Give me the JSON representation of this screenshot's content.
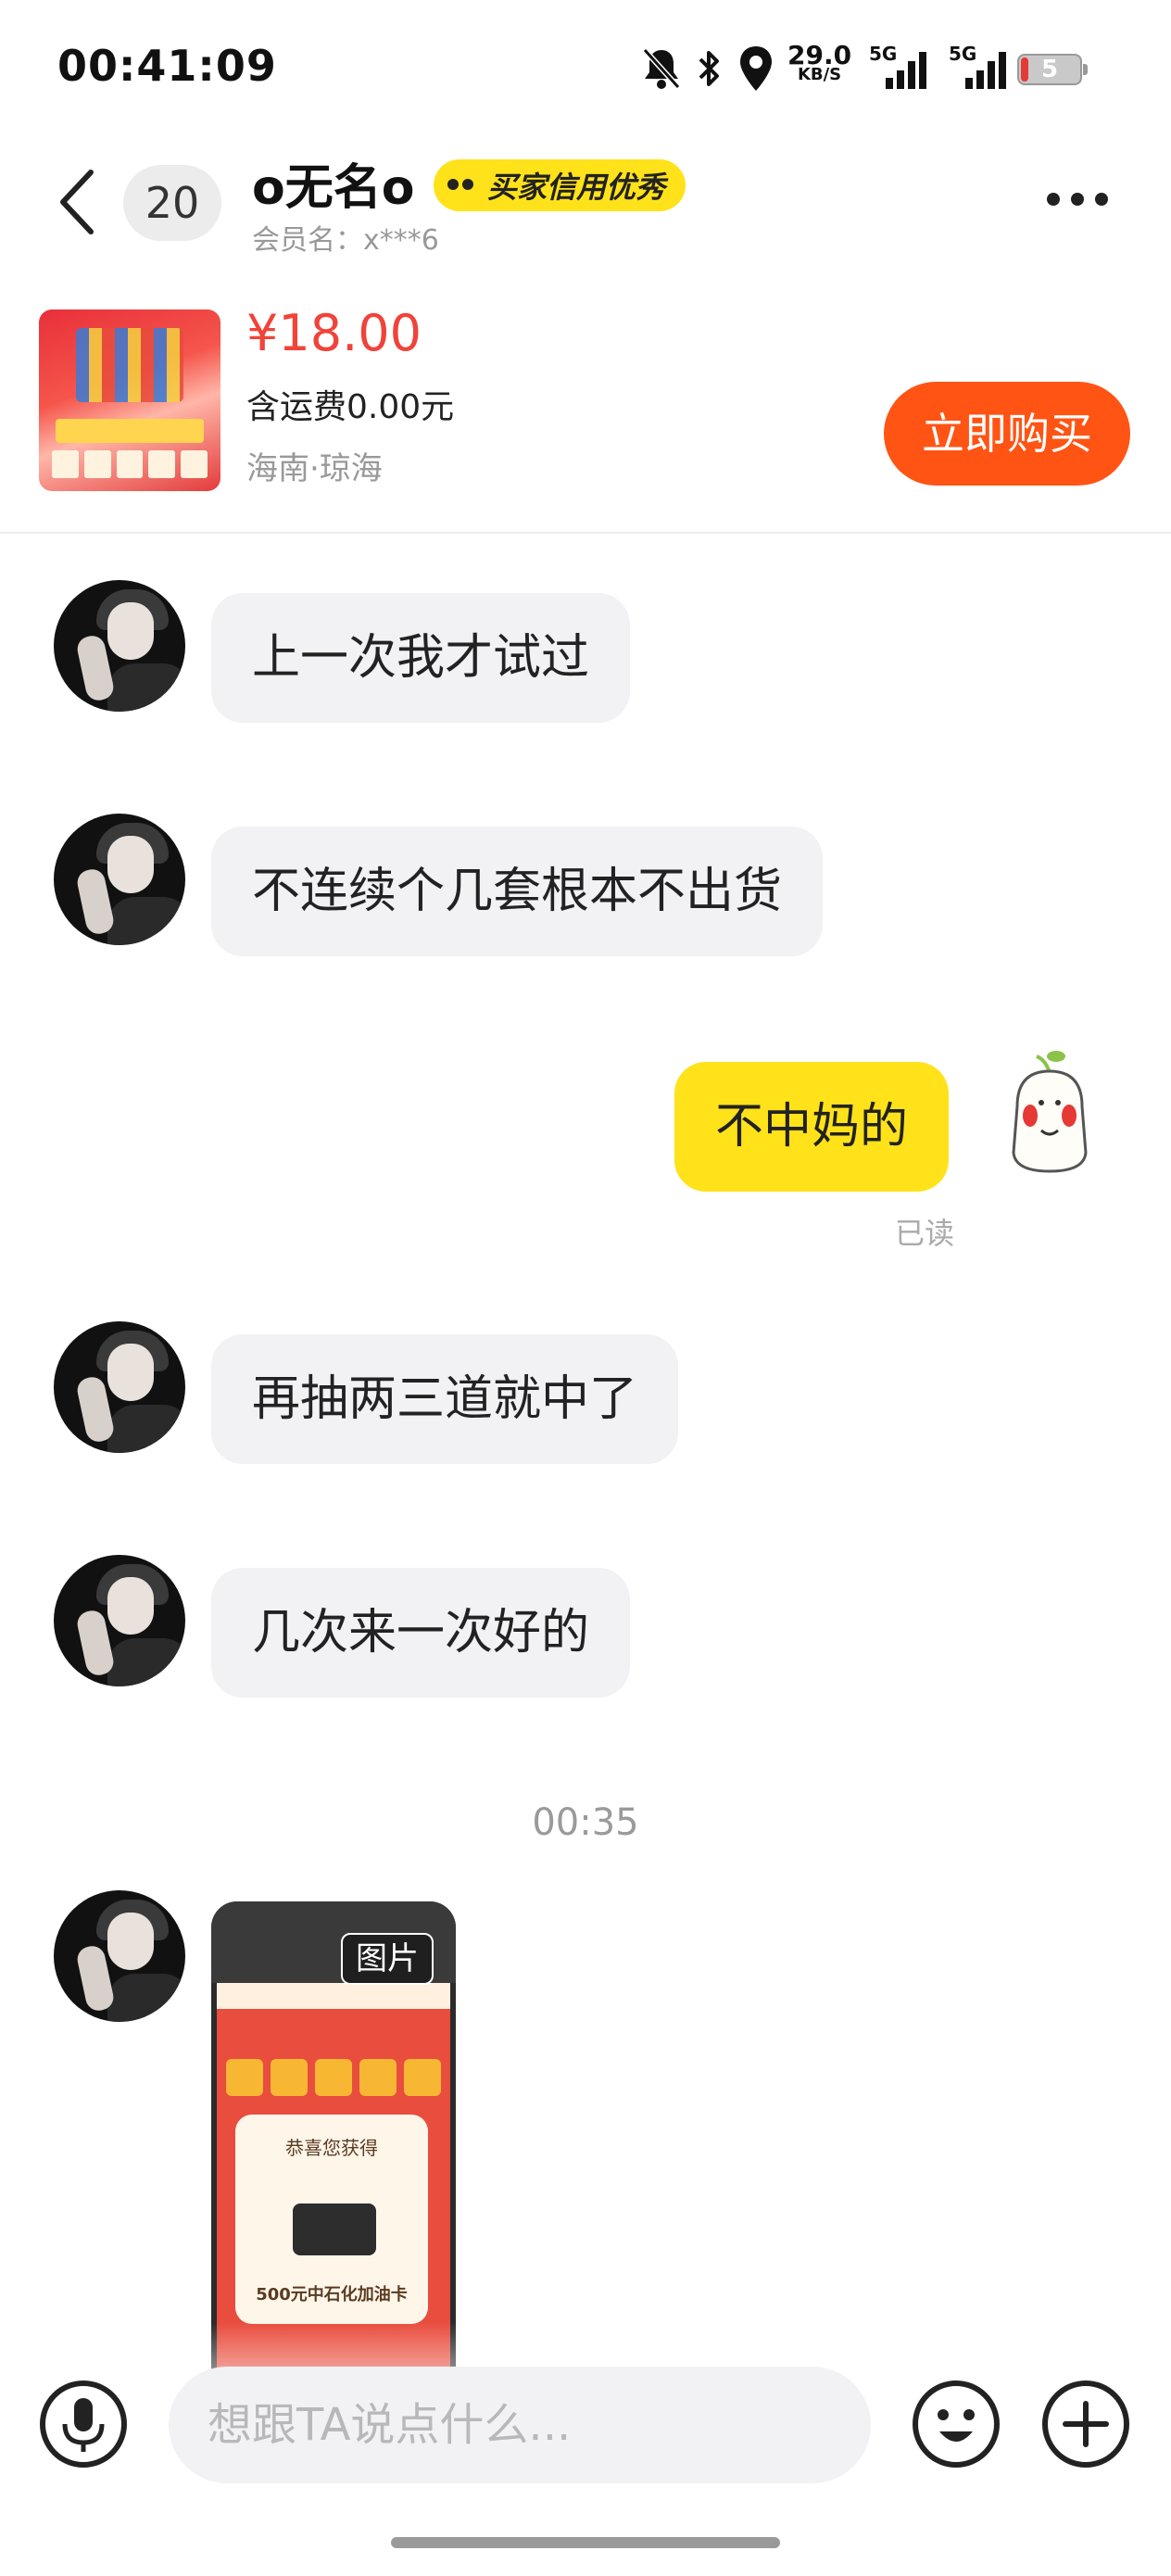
{
  "status_bar": {
    "time": "00:41:09",
    "net_speed": "29.0",
    "net_unit": "KB/S",
    "sim1": "5G",
    "sim2": "5G",
    "battery": "5"
  },
  "header": {
    "unread_count": "20",
    "nickname": "o无名o",
    "credit_badge": "买家信用优秀",
    "member_name": "会员名：x***6"
  },
  "product": {
    "price": "¥18.00",
    "shipping": "含运费0.00元",
    "location": "海南·琼海",
    "buy_label": "立即购买"
  },
  "messages": [
    {
      "direction": "in",
      "text": "上一次我才试过"
    },
    {
      "direction": "in",
      "text": "不连续个几套根本不出货"
    },
    {
      "direction": "out",
      "text": "不中妈的",
      "status": "已读"
    },
    {
      "direction": "in",
      "text": "再抽两三道就中了"
    },
    {
      "direction": "in",
      "text": "几次来一次好的"
    }
  ],
  "timestamp": "00:35",
  "image_message": {
    "tag": "图片",
    "card_title": "恭喜您获得",
    "card_prize": "500元中石化加油卡"
  },
  "input_bar": {
    "placeholder": "想跟TA说点什么..."
  },
  "icons": {
    "back": "chevron-left-icon",
    "more": "more-horizontal-icon",
    "voice": "microphone-icon",
    "emoji": "smiley-icon",
    "plus": "plus-icon"
  },
  "colors": {
    "accent_yellow": "#ffe21a",
    "buy_orange": "#ff5414",
    "price_red": "#f0433a"
  }
}
